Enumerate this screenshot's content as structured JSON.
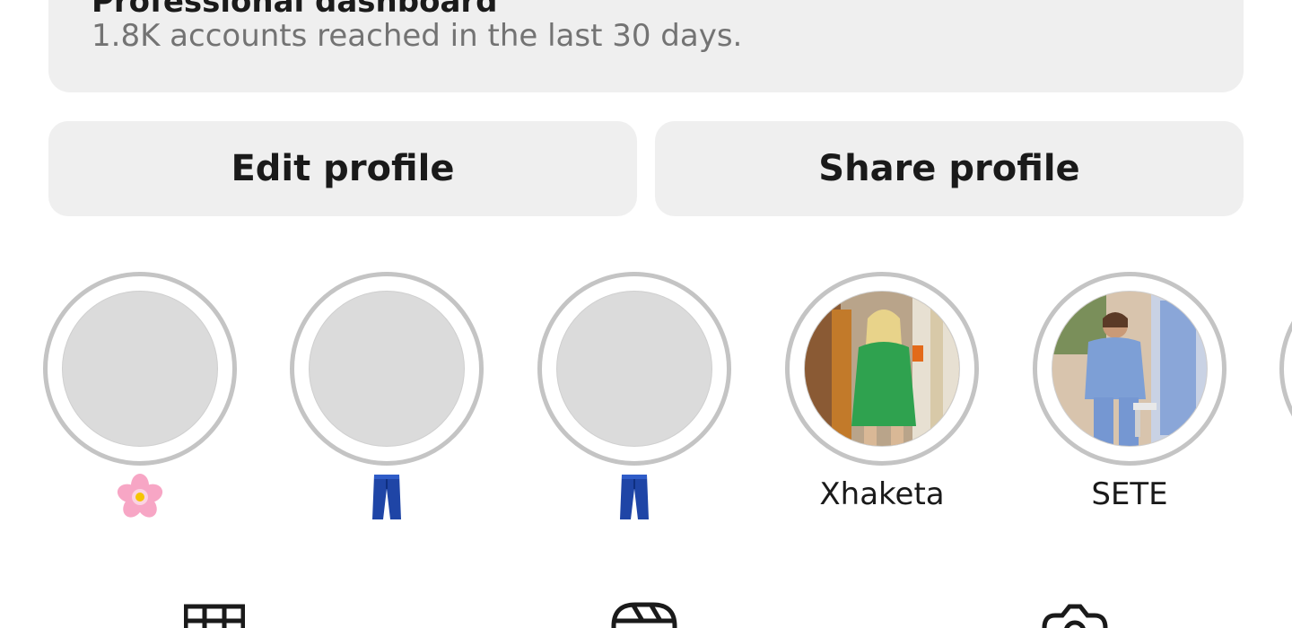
{
  "dashboard": {
    "title": "Professional dashboard",
    "subtitle": "1.8K accounts reached in the last 30 days."
  },
  "buttons": {
    "edit_label": "Edit profile",
    "share_label": "Share profile"
  },
  "highlights": [
    {
      "label": "",
      "icon": "cherry-blossom-icon",
      "cover": "empty"
    },
    {
      "label": "",
      "icon": "jeans-icon",
      "cover": "empty"
    },
    {
      "label": "",
      "icon": "jeans-icon",
      "cover": "empty"
    },
    {
      "label": "Xhaketa",
      "icon": "",
      "cover": "photo"
    },
    {
      "label": "SETE",
      "icon": "",
      "cover": "photo"
    }
  ],
  "tabs": [
    {
      "name": "grid-icon"
    },
    {
      "name": "reels-icon"
    },
    {
      "name": "tagged-icon"
    }
  ],
  "colors": {
    "card_bg": "#efefef",
    "ring": "#c4c4c4",
    "empty_cover": "#dbdbdb",
    "text_primary": "#1a1a1a",
    "text_secondary": "#737373"
  }
}
